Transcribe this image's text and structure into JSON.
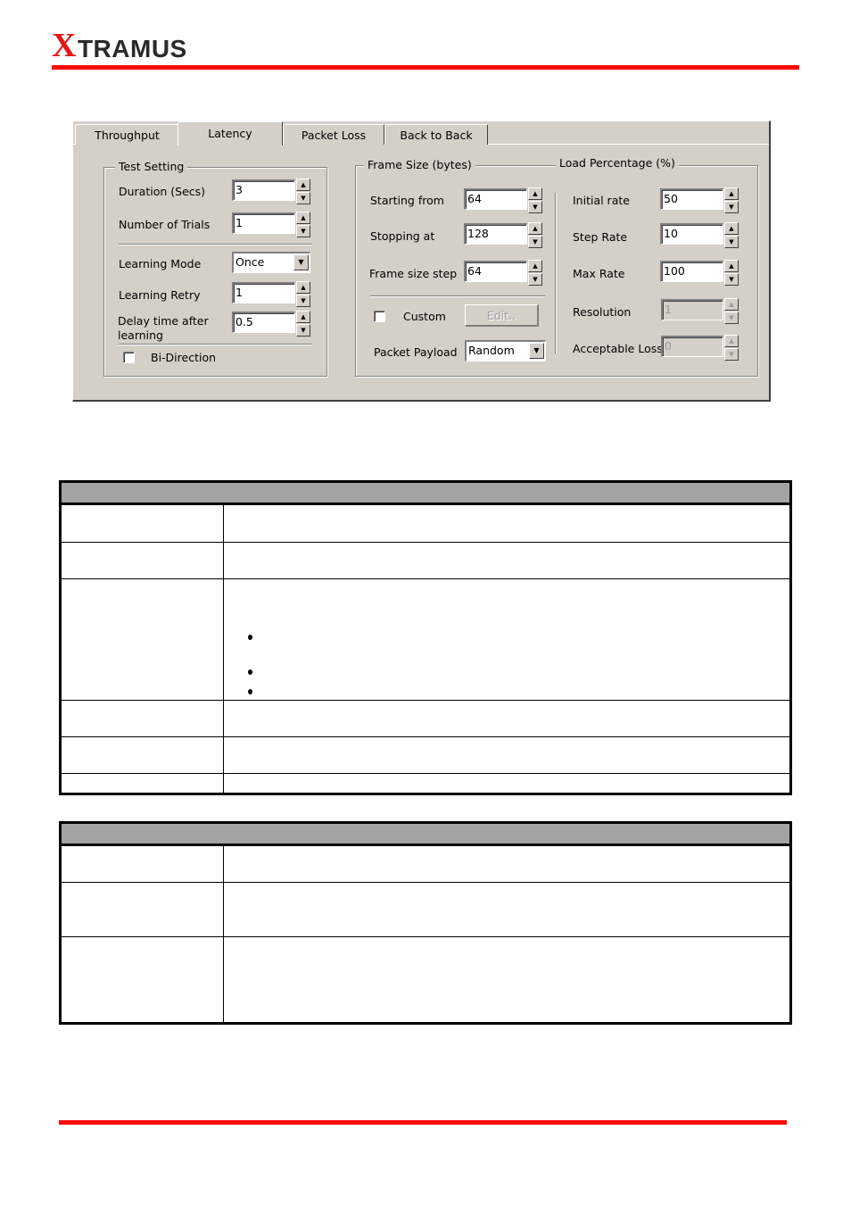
{
  "header": {
    "logo_first_letter": "X",
    "logo_rest": "TRAMUS",
    "accent_color": "#ff0a0a"
  },
  "dialog": {
    "tabs": [
      {
        "label": "Throughput",
        "active": false
      },
      {
        "label": "Latency",
        "active": true
      },
      {
        "label": "Packet Loss",
        "active": false
      },
      {
        "label": "Back to Back",
        "active": false
      }
    ],
    "test_setting": {
      "title": "Test Setting",
      "duration_label": "Duration (Secs)",
      "duration_value": "3",
      "trials_label": "Number of Trials",
      "trials_value": "1",
      "learning_mode_label": "Learning Mode",
      "learning_mode_value": "Once",
      "learning_retry_label": "Learning Retry",
      "learning_retry_value": "1",
      "delay_label_line1": "Delay time after",
      "delay_label_line2": "learning",
      "delay_value": "0.5",
      "bidirection_label": "Bi-Direction",
      "bidirection_checked": false
    },
    "frame_size": {
      "title": "Frame Size  (bytes)",
      "starting_label": "Starting from",
      "starting_value": "64",
      "stopping_label": "Stopping at",
      "stopping_value": "128",
      "step_label": "Frame size step",
      "step_value": "64",
      "custom_label": "Custom",
      "custom_checked": false,
      "edit_button": "Edit..",
      "payload_label": "Packet Payload",
      "payload_value": "Random"
    },
    "load_percentage": {
      "title": "Load Percentage (%)",
      "initial_label": "Initial rate",
      "initial_value": "50",
      "step_label": "Step Rate",
      "step_value": "10",
      "max_label": "Max Rate",
      "max_value": "100",
      "resolution_label": "Resolution",
      "resolution_value": "1",
      "loss_label": "Acceptable Loss",
      "loss_value": "0"
    },
    "spin_up_glyph": "▲",
    "spin_down_glyph": "▼",
    "combo_arrow_glyph": "▼"
  },
  "tables": {
    "table1_rows": 6,
    "table2_rows": 3
  }
}
